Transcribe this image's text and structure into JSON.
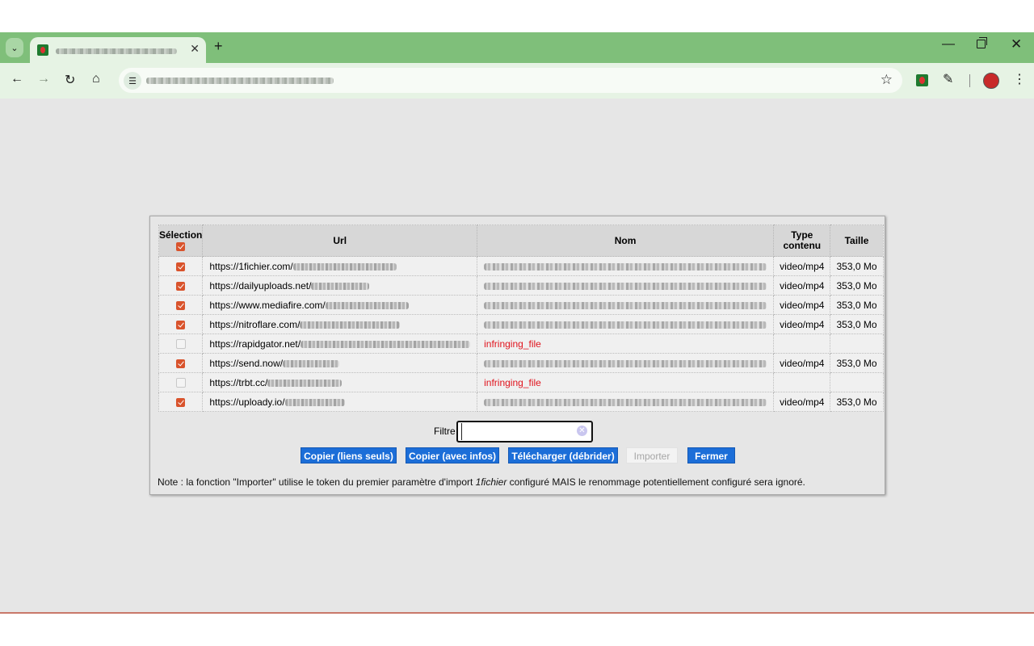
{
  "toolbar": {
    "star_icon": "star-icon",
    "menu_icon": "kebab-menu-icon"
  },
  "table": {
    "headers": {
      "selection": "Sélection",
      "url": "Url",
      "nom": "Nom",
      "type_line1": "Type",
      "type_line2": "contenu",
      "taille": "Taille"
    },
    "rows": [
      {
        "checked": true,
        "url": "https://1fichier.com/",
        "nom": "",
        "type": "video/mp4",
        "size": "353,0 Mo"
      },
      {
        "checked": true,
        "url": "https://dailyuploads.net/",
        "nom": "",
        "type": "video/mp4",
        "size": "353,0 Mo"
      },
      {
        "checked": true,
        "url": "https://www.mediafire.com/",
        "nom": "",
        "type": "video/mp4",
        "size": "353,0 Mo"
      },
      {
        "checked": true,
        "url": "https://nitroflare.com/",
        "nom": "",
        "type": "video/mp4",
        "size": "353,0 Mo"
      },
      {
        "checked": false,
        "url": "https://rapidgator.net/",
        "nom": "infringing_file",
        "type": "",
        "size": ""
      },
      {
        "checked": true,
        "url": "https://send.now/",
        "nom": "",
        "type": "video/mp4",
        "size": "353,0 Mo"
      },
      {
        "checked": false,
        "url": "https://trbt.cc/",
        "nom": "infringing_file",
        "type": "",
        "size": ""
      },
      {
        "checked": true,
        "url": "https://uploady.io/",
        "nom": "",
        "type": "video/mp4",
        "size": "353,0 Mo"
      }
    ]
  },
  "filter": {
    "label": "Filtre",
    "value": ""
  },
  "buttons": {
    "copy_links": "Copier (liens seuls)",
    "copy_infos": "Copier (avec infos)",
    "download": "Télécharger (débrider)",
    "import": "Importer",
    "close": "Fermer"
  },
  "note": {
    "before": "Note : la fonction \"Importer\" utilise le token du premier paramètre d'import ",
    "emphasis": "1fichier",
    "after": " configuré MAIS le renommage potentiellement configuré sera ignoré."
  },
  "colors": {
    "accent_blue": "#1c6ed8",
    "checkbox_orange": "#d9532c",
    "error_red": "#e0141e",
    "chrome_green": "#7fbf7a"
  }
}
